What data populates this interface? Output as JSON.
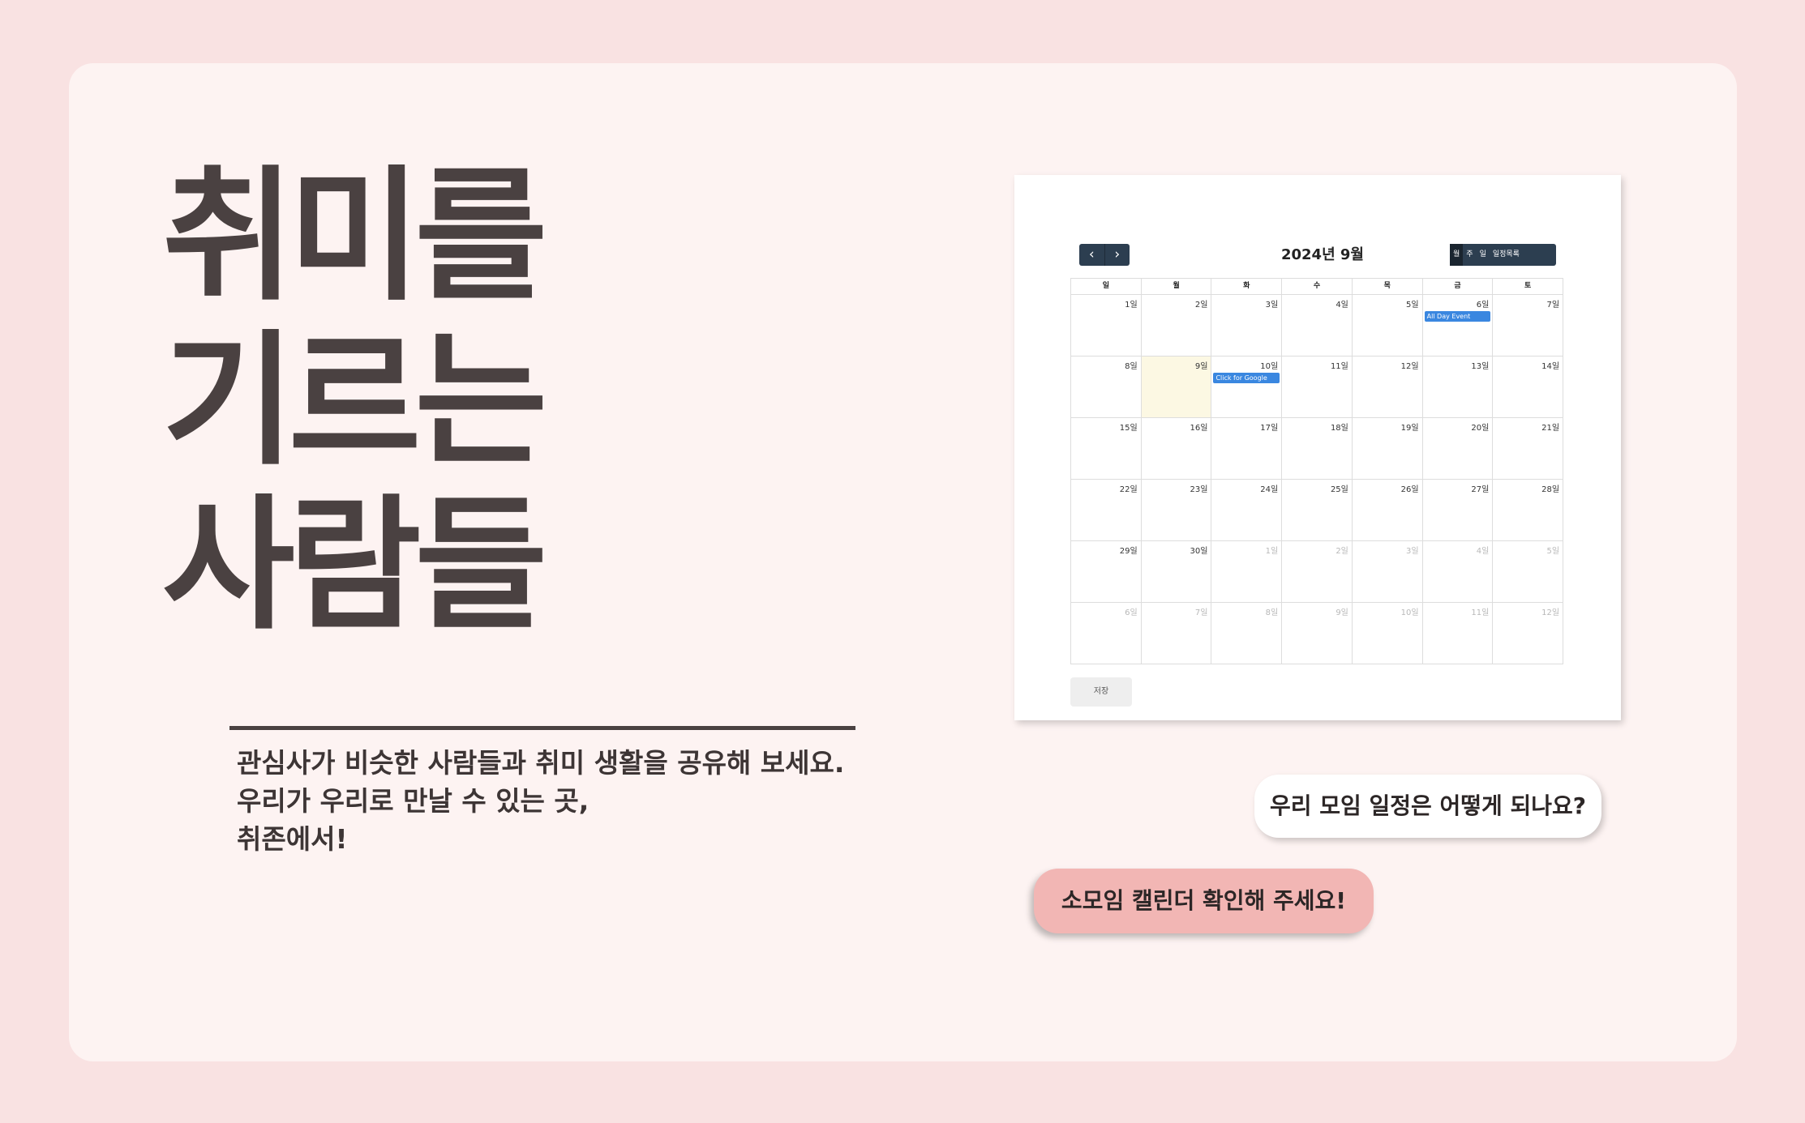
{
  "hero": {
    "title_lines": [
      "취미를",
      "기르는",
      "사람들"
    ],
    "subtitle_lines": [
      "관심사가 비슷한 사람들과 취미 생활을 공유해 보세요.",
      "우리가 우리로 만날 수 있는 곳,",
      "취존에서!"
    ]
  },
  "calendar": {
    "title": "2024년 9월",
    "nav": {
      "prev_icon": "‹",
      "next_icon": "›"
    },
    "views": [
      "월",
      "주",
      "일",
      "일정목록"
    ],
    "active_view": "월",
    "weekdays": [
      "일",
      "월",
      "화",
      "수",
      "목",
      "금",
      "토"
    ],
    "weeks": [
      [
        "1일",
        "2일",
        "3일",
        "4일",
        "5일",
        "6일",
        "7일"
      ],
      [
        "8일",
        "9일",
        "10일",
        "11일",
        "12일",
        "13일",
        "14일"
      ],
      [
        "15일",
        "16일",
        "17일",
        "18일",
        "19일",
        "20일",
        "21일"
      ],
      [
        "22일",
        "23일",
        "24일",
        "25일",
        "26일",
        "27일",
        "28일"
      ],
      [
        "29일",
        "30일",
        "1일",
        "2일",
        "3일",
        "4일",
        "5일"
      ],
      [
        "6일",
        "7일",
        "8일",
        "9일",
        "10일",
        "11일",
        "12일"
      ]
    ],
    "events": [
      {
        "week": 0,
        "day": 5,
        "label": "All Day Event"
      },
      {
        "week": 1,
        "day": 2,
        "label": "Click for Google"
      }
    ],
    "save_label": "저장",
    "colors": {
      "toolbar": "#2c3e50",
      "event": "#3a87e0",
      "today": "#fcf8e3"
    }
  },
  "chat": {
    "question": "우리 모임 일정은 어떻게 되나요?",
    "answer": "소모임 캘린더 확인해 주세요!"
  }
}
